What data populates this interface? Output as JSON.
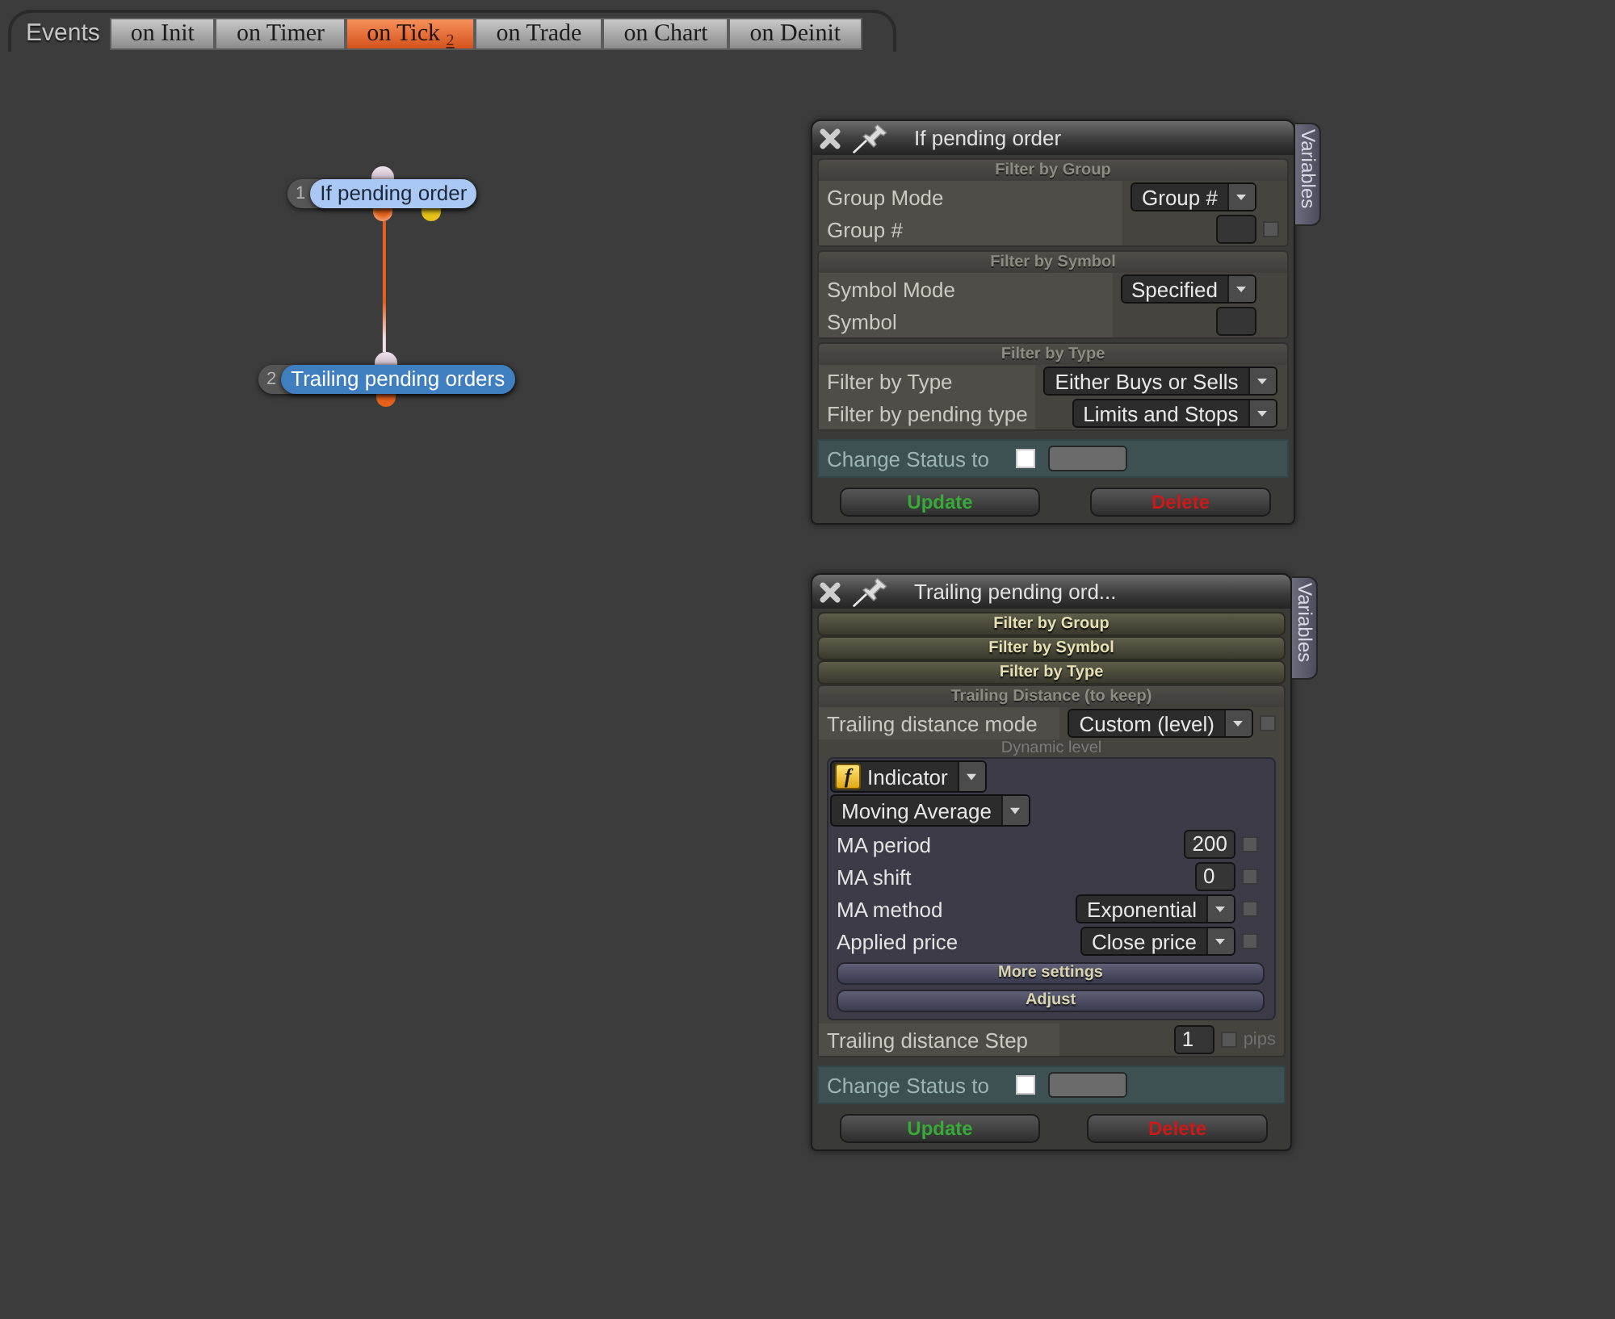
{
  "tab_bar": {
    "label": "Events",
    "tabs": [
      {
        "label": "on Init",
        "selected": false
      },
      {
        "label": "on Timer",
        "selected": false
      },
      {
        "label": "on Tick",
        "count": "2",
        "selected": true
      },
      {
        "label": "on Trade",
        "selected": false
      },
      {
        "label": "on Chart",
        "selected": false
      },
      {
        "label": "on Deinit",
        "selected": false
      }
    ]
  },
  "nodes": [
    {
      "number": "1",
      "label": "If pending order",
      "color": "#a9c8f4",
      "outputs": [
        {
          "color": "#e4621c",
          "connected": true
        },
        {
          "color": "#e6c21a",
          "connected": false
        }
      ]
    },
    {
      "number": "2",
      "label": "Trailing pending orders",
      "color": "#3f7fc0",
      "outputs": [
        {
          "color": "#e4621c",
          "connected": false
        }
      ]
    }
  ],
  "panels": [
    {
      "title": "If pending order",
      "side_tab": "Variables",
      "sections": [
        {
          "title": "Filter by Group",
          "expanded": true,
          "rows": [
            {
              "kind": "select",
              "label": "Group Mode",
              "value": "Group #"
            },
            {
              "kind": "input",
              "label": "Group #",
              "checked": false
            }
          ]
        },
        {
          "title": "Filter by Symbol",
          "expanded": true,
          "rows": [
            {
              "kind": "select",
              "label": "Symbol Mode",
              "value": "Specified"
            },
            {
              "kind": "input",
              "label": "Symbol"
            }
          ]
        },
        {
          "title": "Filter by Type",
          "expanded": true,
          "rows": [
            {
              "kind": "select",
              "label": "Filter by Type",
              "value": "Either Buys or Sells"
            },
            {
              "kind": "select",
              "label": "Filter by pending type",
              "value": "Limits and Stops"
            }
          ]
        }
      ],
      "status": {
        "label": "Change Status to",
        "checked": false
      },
      "buttons": [
        {
          "label": "Update",
          "kind": "confirm"
        },
        {
          "label": "Delete",
          "kind": "danger"
        }
      ]
    },
    {
      "title": "Trailing pending ord...",
      "side_tab": "Variables",
      "sections": [
        {
          "title": "Filter by Group",
          "expanded": false
        },
        {
          "title": "Filter by Symbol",
          "expanded": false
        },
        {
          "title": "Filter by Type",
          "expanded": false
        },
        {
          "title": "Trailing Distance (to keep)",
          "expanded": true,
          "rows": [
            {
              "kind": "select",
              "label": "Trailing distance mode",
              "value": "Custom (level)",
              "checked": false
            },
            {
              "kind": "group",
              "caption": "Dynamic level",
              "source": {
                "icon": "f",
                "value": "Indicator"
              },
              "indicator": "Moving Average",
              "params": [
                {
                  "kind": "input",
                  "label": "MA period",
                  "value": "200",
                  "checked": false
                },
                {
                  "kind": "input",
                  "label": "MA shift",
                  "value": "0",
                  "checked": false
                },
                {
                  "kind": "select",
                  "label": "MA method",
                  "value": "Exponential",
                  "checked": false
                },
                {
                  "kind": "select",
                  "label": "Applied price",
                  "value": "Close price",
                  "checked": false
                }
              ],
              "buttons": [
                "More settings",
                "Adjust"
              ]
            },
            {
              "kind": "input",
              "label": "Trailing distance Step",
              "value": "1",
              "checked": false,
              "unit": "pips"
            }
          ]
        }
      ],
      "status": {
        "label": "Change Status to",
        "checked": false
      },
      "buttons": [
        {
          "label": "Update",
          "kind": "confirm"
        },
        {
          "label": "Delete",
          "kind": "danger"
        }
      ]
    }
  ]
}
